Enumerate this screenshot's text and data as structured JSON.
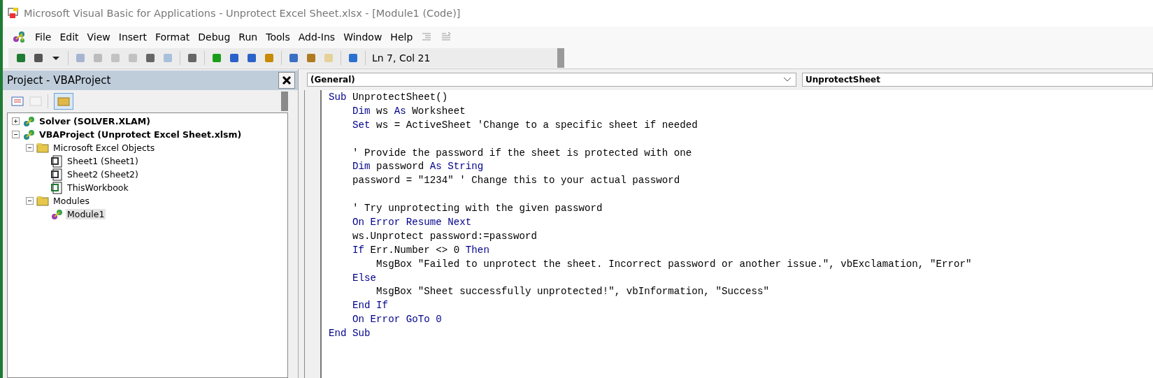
{
  "window": {
    "title": "Microsoft Visual Basic for Applications - Unprotect Excel Sheet.xlsx - [Module1 (Code)]"
  },
  "menu": [
    "File",
    "Edit",
    "View",
    "Insert",
    "Format",
    "Debug",
    "Run",
    "Tools",
    "Add-Ins",
    "Window",
    "Help"
  ],
  "toolbar": {
    "buttons": [
      {
        "disabled": false
      },
      {
        "disabled": false
      },
      {
        "disabled": false
      },
      {
        "disabled": true
      },
      {
        "disabled": true
      },
      {
        "disabled": true
      },
      {
        "disabled": true
      },
      {
        "disabled": false
      },
      {
        "disabled": true
      },
      {
        "disabled": false
      },
      {
        "disabled": false
      },
      {
        "disabled": false
      },
      {
        "disabled": false
      },
      {
        "disabled": false
      },
      {
        "disabled": false
      },
      {
        "disabled": false
      },
      {
        "disabled": true
      },
      {
        "disabled": false
      }
    ],
    "position": "Ln 7, Col 21"
  },
  "project": {
    "title": "Project - VBAProject",
    "tree": [
      {
        "label": "Solver (SOLVER.XLAM)",
        "kind": "project",
        "expanded": false,
        "selected": false
      },
      {
        "label": "VBAProject (Unprotect Excel Sheet.xlsm)",
        "kind": "project",
        "expanded": true,
        "selected": false,
        "children": [
          {
            "label": "Microsoft Excel Objects",
            "kind": "folder",
            "expanded": true,
            "selected": false,
            "children": [
              {
                "label": "Sheet1 (Sheet1)",
                "kind": "sheet",
                "selected": false
              },
              {
                "label": "Sheet2 (Sheet2)",
                "kind": "sheet",
                "selected": false
              },
              {
                "label": "ThisWorkbook",
                "kind": "workbook",
                "selected": false
              }
            ]
          },
          {
            "label": "Modules",
            "kind": "folder",
            "expanded": true,
            "selected": false,
            "children": [
              {
                "label": "Module1",
                "kind": "module",
                "selected": true
              }
            ]
          }
        ]
      }
    ]
  },
  "code": {
    "object": "(General)",
    "procedure": "UnprotectSheet",
    "lines": [
      {
        "tokens": [
          {
            "kind": "keyword",
            "text": "Sub"
          },
          {
            "kind": "plain",
            "text": " UnprotectSheet()"
          }
        ]
      },
      {
        "tokens": [
          {
            "kind": "keyword",
            "text": "    Dim"
          },
          {
            "kind": "plain",
            "text": " ws "
          },
          {
            "kind": "keyword",
            "text": "As"
          },
          {
            "kind": "plain",
            "text": " Worksheet"
          }
        ]
      },
      {
        "tokens": [
          {
            "kind": "keyword",
            "text": "    Set"
          },
          {
            "kind": "plain",
            "text": " ws = ActiveSheet 'Change to a specific sheet if needed"
          }
        ]
      },
      {
        "kind": "blank"
      },
      {
        "tokens": [
          {
            "kind": "plain",
            "text": "    ' Provide the password if the sheet is protected with one"
          }
        ]
      },
      {
        "tokens": [
          {
            "kind": "keyword",
            "text": "    Dim"
          },
          {
            "kind": "plain",
            "text": " password "
          },
          {
            "kind": "keyword",
            "text": "As String"
          }
        ]
      },
      {
        "tokens": [
          {
            "kind": "plain",
            "text": "    password = \"1234\" ' Change this to your actual password"
          }
        ]
      },
      {
        "kind": "blank"
      },
      {
        "tokens": [
          {
            "kind": "plain",
            "text": "    ' Try unprotecting with the given password"
          }
        ]
      },
      {
        "tokens": [
          {
            "kind": "keyword",
            "text": "    On Error Resume Next"
          }
        ]
      },
      {
        "tokens": [
          {
            "kind": "plain",
            "text": "    ws.Unprotect password:=password"
          }
        ]
      },
      {
        "tokens": [
          {
            "kind": "keyword",
            "text": "    If"
          },
          {
            "kind": "plain",
            "text": " Err.Number <> 0 "
          },
          {
            "kind": "keyword",
            "text": "Then"
          }
        ]
      },
      {
        "tokens": [
          {
            "kind": "plain",
            "text": "        MsgBox \"Failed to unprotect the sheet. Incorrect password or another issue.\", vbExclamation, \"Error\""
          }
        ]
      },
      {
        "tokens": [
          {
            "kind": "keyword",
            "text": "    Else"
          }
        ]
      },
      {
        "tokens": [
          {
            "kind": "plain",
            "text": "        MsgBox \"Sheet successfully unprotected!\", vbInformation, \"Success\""
          }
        ]
      },
      {
        "tokens": [
          {
            "kind": "keyword",
            "text": "    End If"
          }
        ]
      },
      {
        "tokens": [
          {
            "kind": "keyword",
            "text": "    On Error GoTo 0"
          }
        ]
      },
      {
        "tokens": [
          {
            "kind": "keyword",
            "text": "End Sub"
          }
        ]
      }
    ]
  }
}
